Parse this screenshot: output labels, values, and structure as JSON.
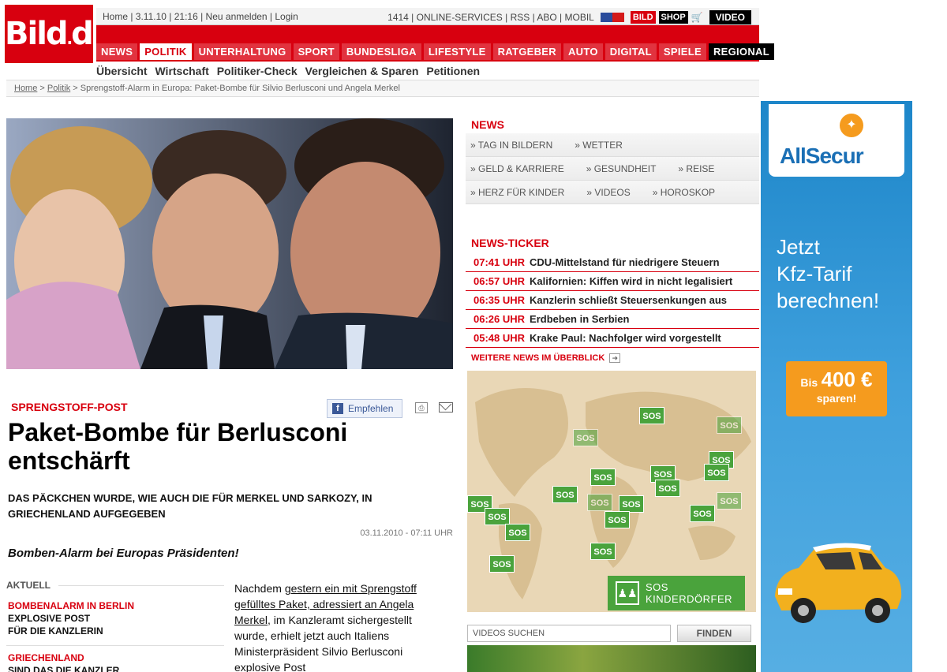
{
  "header": {
    "logo_main": "Bild",
    "logo_dot": ".",
    "logo_tld": "de",
    "topbar_left": "Home | 3.11.10 | 21:16 | Neu anmelden | Login",
    "topbar_right": "1414 | ONLINE-SERVICES | RSS | ABO | MOBIL",
    "bild_label": "BILD",
    "shop_label": "SHOP",
    "video_label": "VIDEO"
  },
  "nav": {
    "items": [
      "NEWS",
      "POLITIK",
      "UNTERHALTUNG",
      "SPORT",
      "BUNDESLIGA",
      "LIFESTYLE",
      "RATGEBER",
      "AUTO",
      "DIGITAL",
      "SPIELE",
      "REGIONAL"
    ],
    "active": "POLITIK",
    "sub": [
      "Übersicht",
      "Wirtschaft",
      "Politiker-Check",
      "Vergleichen & Sparen",
      "Petitionen"
    ]
  },
  "breadcrumb": {
    "home": "Home",
    "sep1": " > ",
    "politik": "Politik",
    "sep2": " > ",
    "current": "Sprengstoff-Alarm in Europa: Paket-Bombe für Silvio Berlusconi und Angela Merkel"
  },
  "article": {
    "kicker": "SPRENGSTOFF-POST",
    "like_label": "Empfehlen",
    "fb_letter": "f",
    "headline": "Paket-Bombe für Berlusconi entschärft",
    "deck": "DAS PÄCKCHEN WURDE, WIE AUCH DIE FÜR MERKEL UND SARKOZY, IN GRIECHENLAND AUFGEGEBEN",
    "date": "03.11.2010 - 07:11 UHR",
    "teaser": "Bomben-Alarm bei Europas Präsidenten!",
    "body_prefix": "Nachdem ",
    "body_link": "gestern ein mit Sprengstoff gefülltes Paket, adressiert an Angela Merkel",
    "body_rest": ", im Kanzleramt sichergestellt wurde, erhielt jetzt auch Italiens Ministerpräsident Silvio Berlusconi explosive Post"
  },
  "aktuell": {
    "label": "AKTUELL",
    "items": [
      {
        "kicker": "BOMBENALARM IN BERLIN",
        "title": "EXPLOSIVE POST FÜR DIE KANZLERIN"
      },
      {
        "kicker": "GRIECHENLAND",
        "title": "SIND DAS DIE KANZLER"
      }
    ]
  },
  "news": {
    "title": "NEWS",
    "rows": [
      [
        "» TAG IN BILDERN",
        "» WETTER"
      ],
      [
        "» GELD & KARRIERE",
        "» GESUNDHEIT",
        "» REISE"
      ],
      [
        "» HERZ FÜR KINDER",
        "» VIDEOS",
        "» HOROSKOP"
      ]
    ]
  },
  "ticker": {
    "title": "NEWS-TICKER",
    "items": [
      {
        "time": "07:41 UHR",
        "text": "CDU-Mittelstand für niedrigere Steuern"
      },
      {
        "time": "06:57 UHR",
        "text": "Kalifornien: Kiffen wird in nicht legalisiert"
      },
      {
        "time": "06:35 UHR",
        "text": "Kanzlerin schließt Steuersenkungen aus"
      },
      {
        "time": "06:26 UHR",
        "text": "Erdbeben in Serbien"
      },
      {
        "time": "05:48 UHR",
        "text": "Krake Paul: Nachfolger wird vorgestellt"
      }
    ],
    "more": "WEITERE NEWS IM ÜBERBLICK"
  },
  "sos": {
    "pin_label": "SOS",
    "brand_line1": "SOS",
    "brand_line2": "KINDERDÖRFER"
  },
  "video_search": {
    "placeholder": "VIDEOS SUCHEN",
    "button": "FINDEN"
  },
  "ad": {
    "brand": "AllSecur",
    "claim_line1": "Jetzt",
    "claim_line2": "Kfz-Tarif",
    "claim_line3": "berechnen!",
    "promo_prefix": "Bis",
    "promo_amount": "400 €",
    "promo_suffix": "sparen!"
  }
}
